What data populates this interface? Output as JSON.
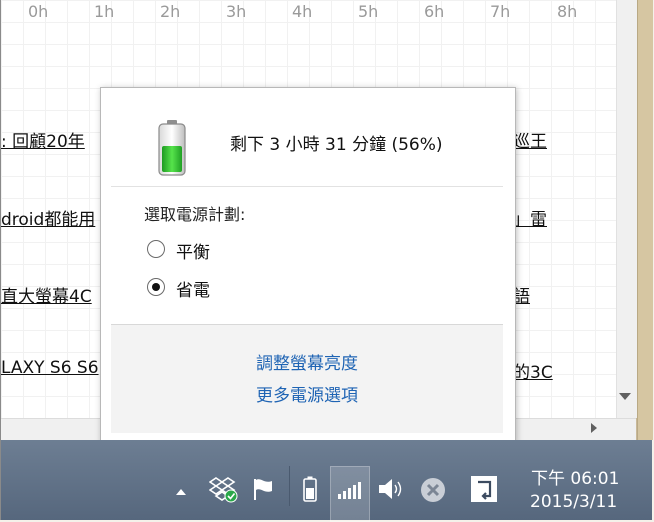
{
  "background": {
    "hour_labels": [
      "0h",
      "1h",
      "2h",
      "3h",
      "4h",
      "5h",
      "6h",
      "7h",
      "8h"
    ],
    "rows": [
      {
        "left": ": 回顧20年",
        "right": "巡王"
      },
      {
        "left": "droid都能用",
        "right": "」雷"
      },
      {
        "left": "直大螢幕4C",
        "right": "語"
      },
      {
        "left": "LAXY S6 S6",
        "right": "的3C"
      }
    ]
  },
  "popup": {
    "battery_status": "剩下 3 小時 31 分鐘 (56%)",
    "plan_label": "選取電源計劃:",
    "plans": [
      {
        "label": "平衡",
        "selected": false
      },
      {
        "label": "省電",
        "selected": true
      }
    ],
    "links": {
      "brightness": "調整螢幕亮度",
      "more_options": "更多電源選項"
    },
    "battery_level": 0.56
  },
  "taskbar": {
    "time": "下午 06:01",
    "date": "2015/3/11",
    "icons": [
      "show-hidden-icons",
      "dropbox-icon",
      "action-center-flag-icon",
      "battery-icon",
      "network-signal-icon",
      "volume-icon",
      "close-circle-icon",
      "show-desktop-icon"
    ]
  },
  "colors": {
    "link": "#1f64b4",
    "battery_green": "#3fc93a",
    "taskbar": "#5d6f86"
  }
}
